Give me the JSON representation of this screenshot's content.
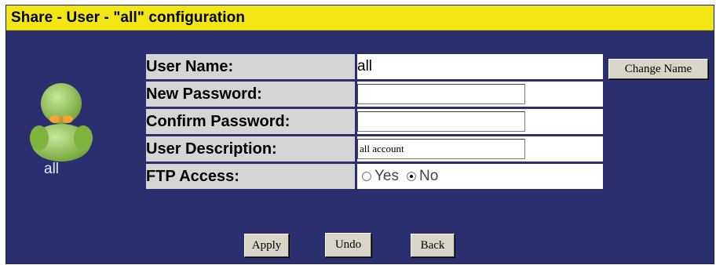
{
  "title": "Share - User - \"all\" configuration",
  "user": {
    "avatar_label": "all"
  },
  "form": {
    "rows": [
      {
        "label": "User Name:",
        "value": "all"
      },
      {
        "label": "New Password:",
        "value": ""
      },
      {
        "label": "Confirm Password:",
        "value": ""
      },
      {
        "label": "User Description:",
        "value": "all account"
      },
      {
        "label": "FTP Access:",
        "options": [
          "Yes",
          "No"
        ],
        "selected": "No"
      }
    ]
  },
  "buttons": {
    "change_name": "Change Name",
    "apply": "Apply",
    "undo": "Undo",
    "back": "Back"
  },
  "colors": {
    "background": "#2b2f6f",
    "title_bar": "#f2e614",
    "label_cell": "#d5d5d5",
    "avatar": "#8fc24a"
  },
  "icons": {
    "avatar": "user-avatar-icon"
  }
}
